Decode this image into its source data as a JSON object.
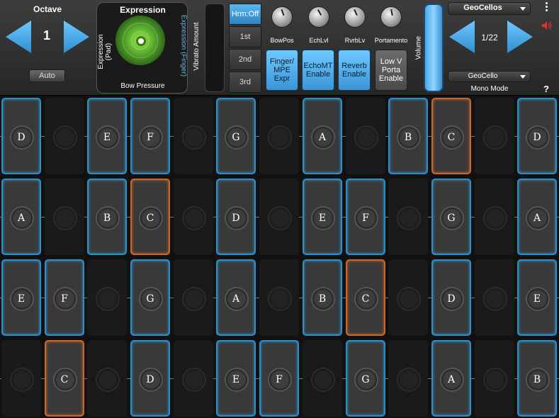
{
  "octave": {
    "title": "Octave",
    "value": "1",
    "auto_label": "Auto"
  },
  "expression": {
    "title": "Expression",
    "left_axis": "Expression (Pad)",
    "right_axis": "Expression (Finger)",
    "bottom_axis": "Bow Pressure"
  },
  "vibrato": {
    "label": "Vibrato Amount"
  },
  "harmonics": [
    "Hrm:Off",
    "1st",
    "2nd",
    "3rd"
  ],
  "knobs": [
    {
      "label": "BowPos"
    },
    {
      "label": "EchLvl"
    },
    {
      "label": "RvrbLv"
    },
    {
      "label": "Portamento"
    }
  ],
  "toggles": [
    {
      "label": "Finger/\nMPE\nExpr",
      "state": "on"
    },
    {
      "label": "EchoMT\nEnable",
      "state": "on"
    },
    {
      "label": "Reverb\nEnable",
      "state": "on"
    },
    {
      "label": "Low V\nPorta\nEnable",
      "state": "off"
    }
  ],
  "volume": {
    "label": "Volume"
  },
  "preset": {
    "name": "GeoCellos",
    "counter": "1/22",
    "sub_preset": "GeoCello",
    "mode": "Mono Mode"
  },
  "help_label": "?",
  "colors": {
    "accent": "#2e8fc9",
    "active": "#c8682a",
    "button_blue": "#6ec8ff"
  },
  "grid": {
    "rows": [
      [
        "D",
        "",
        "E",
        "F",
        "",
        "G",
        "",
        "A",
        "",
        "B",
        "C*",
        "",
        "D"
      ],
      [
        "A",
        "",
        "B",
        "C*",
        "",
        "D",
        "",
        "E",
        "F",
        "",
        "G",
        "",
        "A"
      ],
      [
        "E",
        "F",
        "",
        "G",
        "",
        "A",
        "",
        "B",
        "C*",
        "",
        "D",
        "",
        "E"
      ],
      [
        "",
        "C*",
        "",
        "D",
        "",
        "E",
        "F",
        "",
        "G",
        "",
        "A",
        "",
        "B"
      ]
    ]
  }
}
